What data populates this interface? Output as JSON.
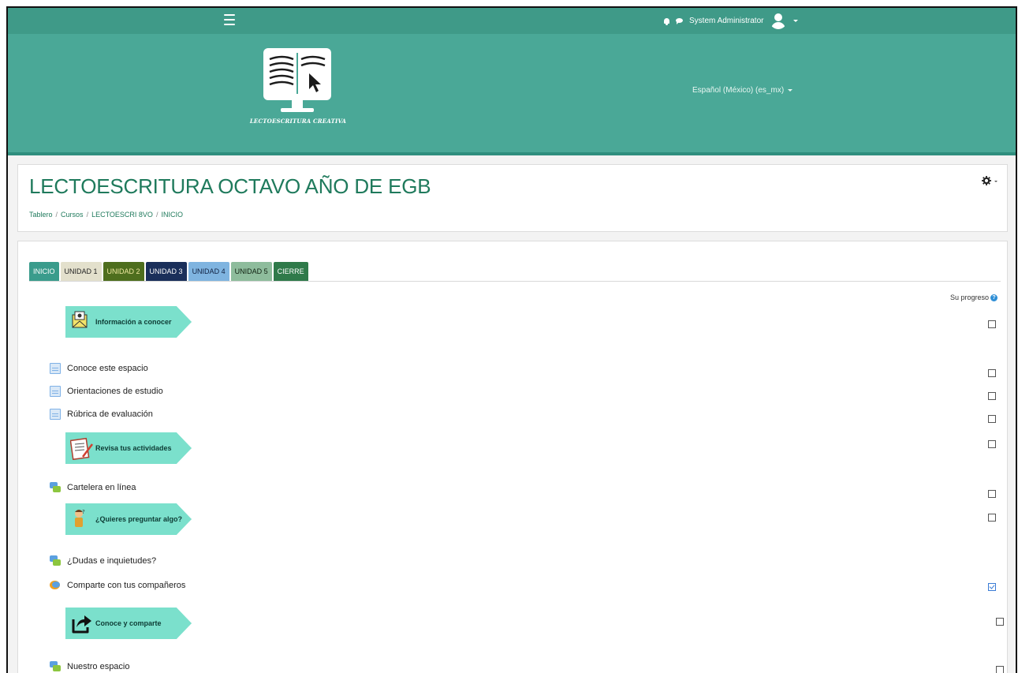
{
  "navbar": {
    "user_name": "System Administrator"
  },
  "banner": {
    "logo_text": "LECTOESCRITURA CREATIVA",
    "language": "Español (México) (es_mx)"
  },
  "course": {
    "title": "LECTOESCRITURA OCTAVO AÑO DE EGB",
    "breadcrumb": [
      "Tablero",
      "Cursos",
      "LECTOESCRI 8VO",
      "INICIO"
    ]
  },
  "tabs": [
    {
      "label": "INICIO",
      "bg": "#3a9c8c",
      "fg": "#ffffff"
    },
    {
      "label": "UNIDAD 1",
      "bg": "#e3e0cc",
      "fg": "#222222"
    },
    {
      "label": "UNIDAD 2",
      "bg": "#4e6e1e",
      "fg": "#f0e8a0"
    },
    {
      "label": "UNIDAD 3",
      "bg": "#1a2f5a",
      "fg": "#ffffff"
    },
    {
      "label": "UNIDAD 4",
      "bg": "#7fb4e0",
      "fg": "#102040"
    },
    {
      "label": "UNIDAD 5",
      "bg": "#8ebc9c",
      "fg": "#102010"
    },
    {
      "label": "CIERRE",
      "bg": "#2f7a4a",
      "fg": "#ffffff"
    }
  ],
  "progress": {
    "label": "Su progreso"
  },
  "labels": {
    "info": "Información a conocer",
    "revisa": "Revisa tus actividades",
    "pregunta": "¿Quieres preguntar algo?",
    "conoce": "Conoce y comparte"
  },
  "activities": {
    "conoce": "Conoce este espacio",
    "orientaciones": "Orientaciones de estudio",
    "rubrica": "Rúbrica de evaluación",
    "cartelera": "Cartelera en línea",
    "dudas": "¿Dudas e inquietudes?",
    "comparte": "Comparte con tus compañeros",
    "nuestro": "Nuestro espacio"
  },
  "completion": {
    "info": false,
    "conoce": false,
    "orientaciones": false,
    "rubrica": false,
    "revisa": false,
    "cartelera": false,
    "pregunta": false,
    "comparte": true,
    "conoce_comparte": false,
    "nuestro": false
  },
  "colors": {
    "navbar": "#3f9a88",
    "banner": "#4aa897",
    "title": "#1f7a5c"
  }
}
